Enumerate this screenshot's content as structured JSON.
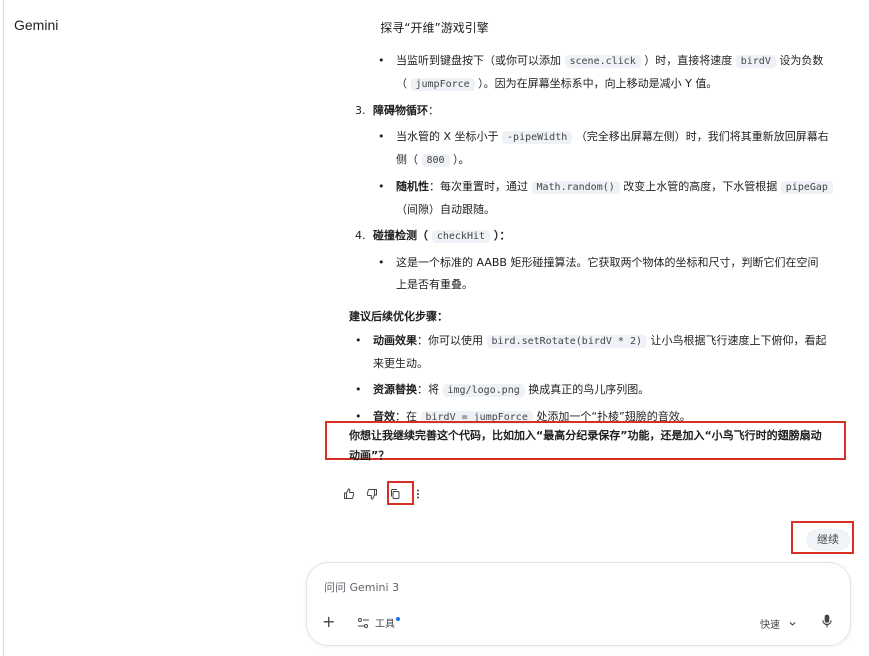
{
  "app": {
    "title": "Gemini"
  },
  "chat": {
    "title": "探寻“开维”游戏引擎"
  },
  "content": {
    "b0": {
      "t1": "当监听到键盘按下（或你可以添加 ",
      "c1": "scene.click",
      "t2": " ）时，直接将速度 ",
      "c2": "birdV",
      "t3": " 设为负数",
      "l2a": "（ ",
      "c3": "jumpForce",
      "l2b": " ）。因为在屏幕坐标系中，向上移动是减小 Y 值。"
    },
    "n3": {
      "num": "3.",
      "label": "障碍物循环",
      "colon": "："
    },
    "b1": {
      "t1": "当水管的 X 坐标小于 ",
      "c1": "-pipeWidth",
      "t2": " （完全移出屏幕左侧）时，我们将其重新放回屏幕右",
      "l2a": "侧（ ",
      "c2": "800",
      "l2b": " ）。"
    },
    "b2": {
      "bold": "随机性",
      "t1": "：每次重置时，通过 ",
      "c1": "Math.random()",
      "t2": " 改变上水管的高度，下水管根据 ",
      "c2": "pipeGap",
      "l2": "（间隙）自动跟随。"
    },
    "n4": {
      "num": "4.",
      "label": "碰撞检测（ ",
      "code": "checkHit",
      "tail": " ）："
    },
    "b3": {
      "l1": "这是一个标准的 AABB 矩形碰撞算法。它获取两个物体的坐标和尺寸，判断它们在空间",
      "l2": "上是否有重叠。"
    },
    "section": "建议后续优化步骤：",
    "s1": {
      "bold": "动画效果",
      "t1": "：你可以使用 ",
      "c1": "bird.setRotate(birdV * 2)",
      "t2": " 让小鸟根据飞行速度上下俯仰，看起",
      "l2": "来更生动。"
    },
    "s2": {
      "bold": "资源替换",
      "t1": "：将 ",
      "c1": "img/logo.png",
      "t2": " 换成真正的鸟儿序列图。"
    },
    "s3": {
      "bold": "音效",
      "t1": "：在 ",
      "c1": "birdV = jumpForce",
      "t2": " 处添加一个“扑棱”翅膀的音效。"
    },
    "question": {
      "l1": "你想让我继续完善这个代码，比如加入“最高分纪录保存”功能，还是加入“小鸟飞行时的翅膀扇动",
      "l2": "动画”？"
    }
  },
  "user": {
    "message": "继续"
  },
  "composer": {
    "placeholder": "问问 Gemini 3",
    "plus": "+",
    "tools_label": "工具",
    "mode_label": "快速"
  },
  "icons": {
    "like": "thumb-up-icon",
    "dislike": "thumb-down-icon",
    "copy": "copy-icon",
    "more": "more-vert-icon",
    "mic": "mic-icon",
    "tools": "tune-icon",
    "chevron": "chevron-down-icon"
  },
  "colors": {
    "highlight_box": "#d93025",
    "code_bg": "#eef1f5",
    "bubble_bg": "#f0f4f9",
    "accent_dot": "#1a73e8"
  }
}
